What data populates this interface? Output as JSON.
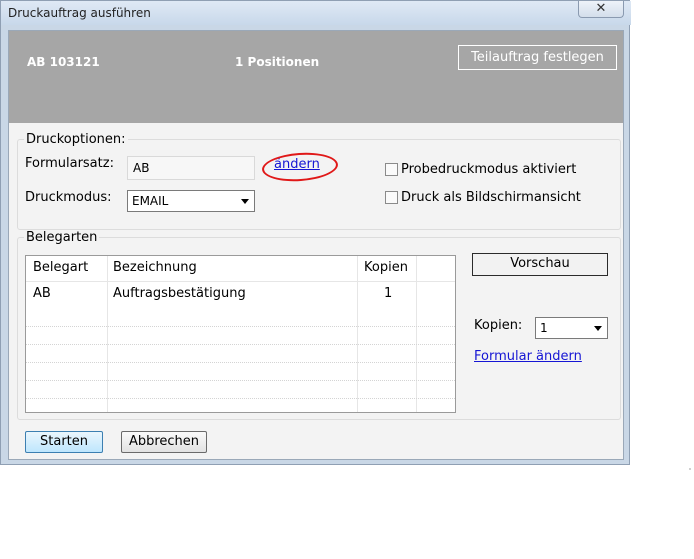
{
  "window": {
    "title": "Druckauftrag ausführen",
    "close_glyph": "✕"
  },
  "header": {
    "order": "AB 103121",
    "positions": "1 Positionen",
    "partial_order_button": "Teilauftrag festlegen"
  },
  "print_options": {
    "group_label": "Druckoptionen:",
    "form_set_label": "Formularsatz:",
    "form_set_value": "AB",
    "change_link": "ändern",
    "print_mode_label": "Druckmodus:",
    "print_mode_value": "EMAIL",
    "test_print_label": "Probedruckmodus aktiviert",
    "screen_view_label": "Druck als Bildschirmansicht"
  },
  "document_types": {
    "group_label": "Belegarten",
    "columns": [
      "Belegart",
      "Bezeichnung",
      "Kopien"
    ],
    "rows": [
      {
        "type": "AB",
        "description": "Auftragsbestätigung",
        "copies": "1"
      }
    ],
    "preview_button": "Vorschau",
    "copies_label": "Kopien:",
    "copies_value": "1",
    "change_form_link": "Formular ändern"
  },
  "footer": {
    "start_button": "Starten",
    "cancel_button": "Abbrechen"
  },
  "colors": {
    "header_bg": "#a6a6a6",
    "link": "#1515d4",
    "annotation": "#e01818"
  }
}
